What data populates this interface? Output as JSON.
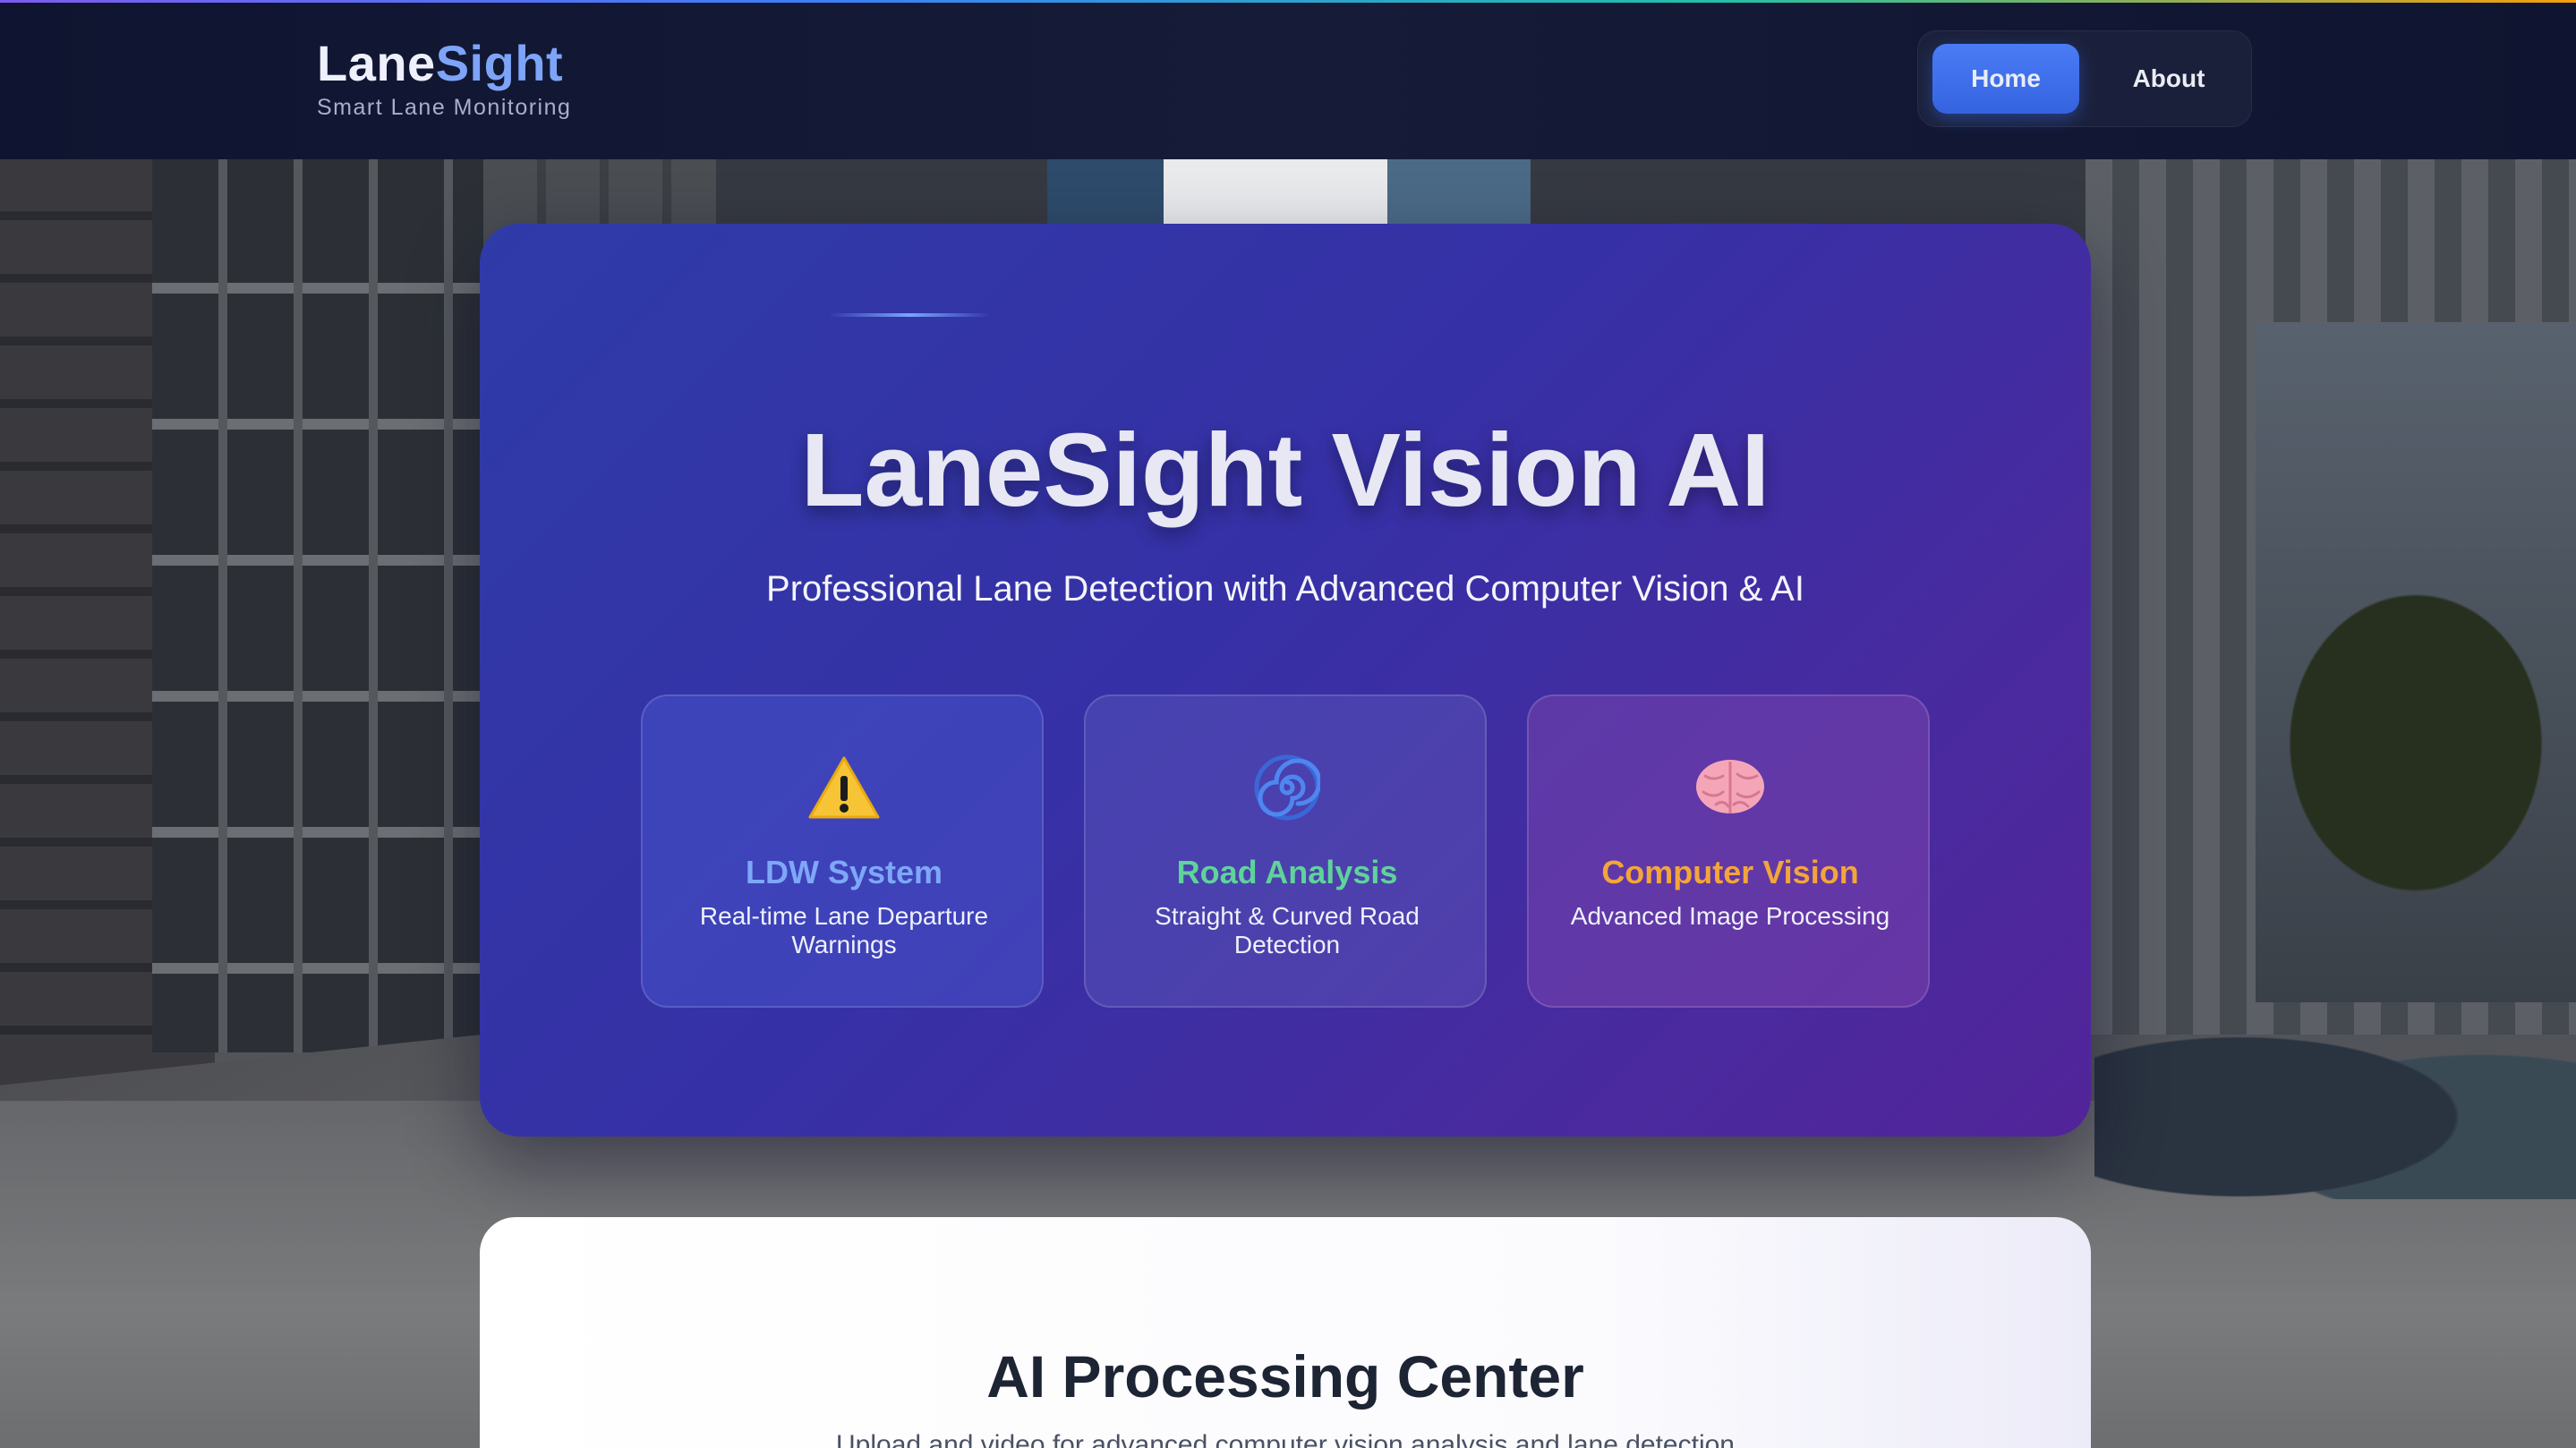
{
  "header": {
    "brand_primary": "Lane",
    "brand_accent": "Sight",
    "tagline": "Smart Lane Monitoring",
    "nav": {
      "home": "Home",
      "about": "About"
    }
  },
  "hero": {
    "title": "LaneSight Vision AI",
    "subtitle": "Professional Lane Detection with Advanced Computer Vision & AI",
    "features": [
      {
        "icon": "warning-icon",
        "title": "LDW System",
        "description": "Real-time Lane Departure Warnings",
        "title_color": "#7ea7f8"
      },
      {
        "icon": "spiral-icon",
        "title": "Road Analysis",
        "description": "Straight & Curved Road Detection",
        "title_color": "#5fd39a"
      },
      {
        "icon": "brain-icon",
        "title": "Computer Vision",
        "description": "Advanced Image Processing",
        "title_color": "#f3a53a"
      }
    ]
  },
  "processing": {
    "title": "AI Processing Center",
    "subtitle": "Upload and video for advanced computer vision analysis and lane detection"
  },
  "colors": {
    "accent": "#3b6be8",
    "header_bg": "#131a35",
    "hero_start": "#2f3ba8",
    "hero_end": "#52249a"
  }
}
